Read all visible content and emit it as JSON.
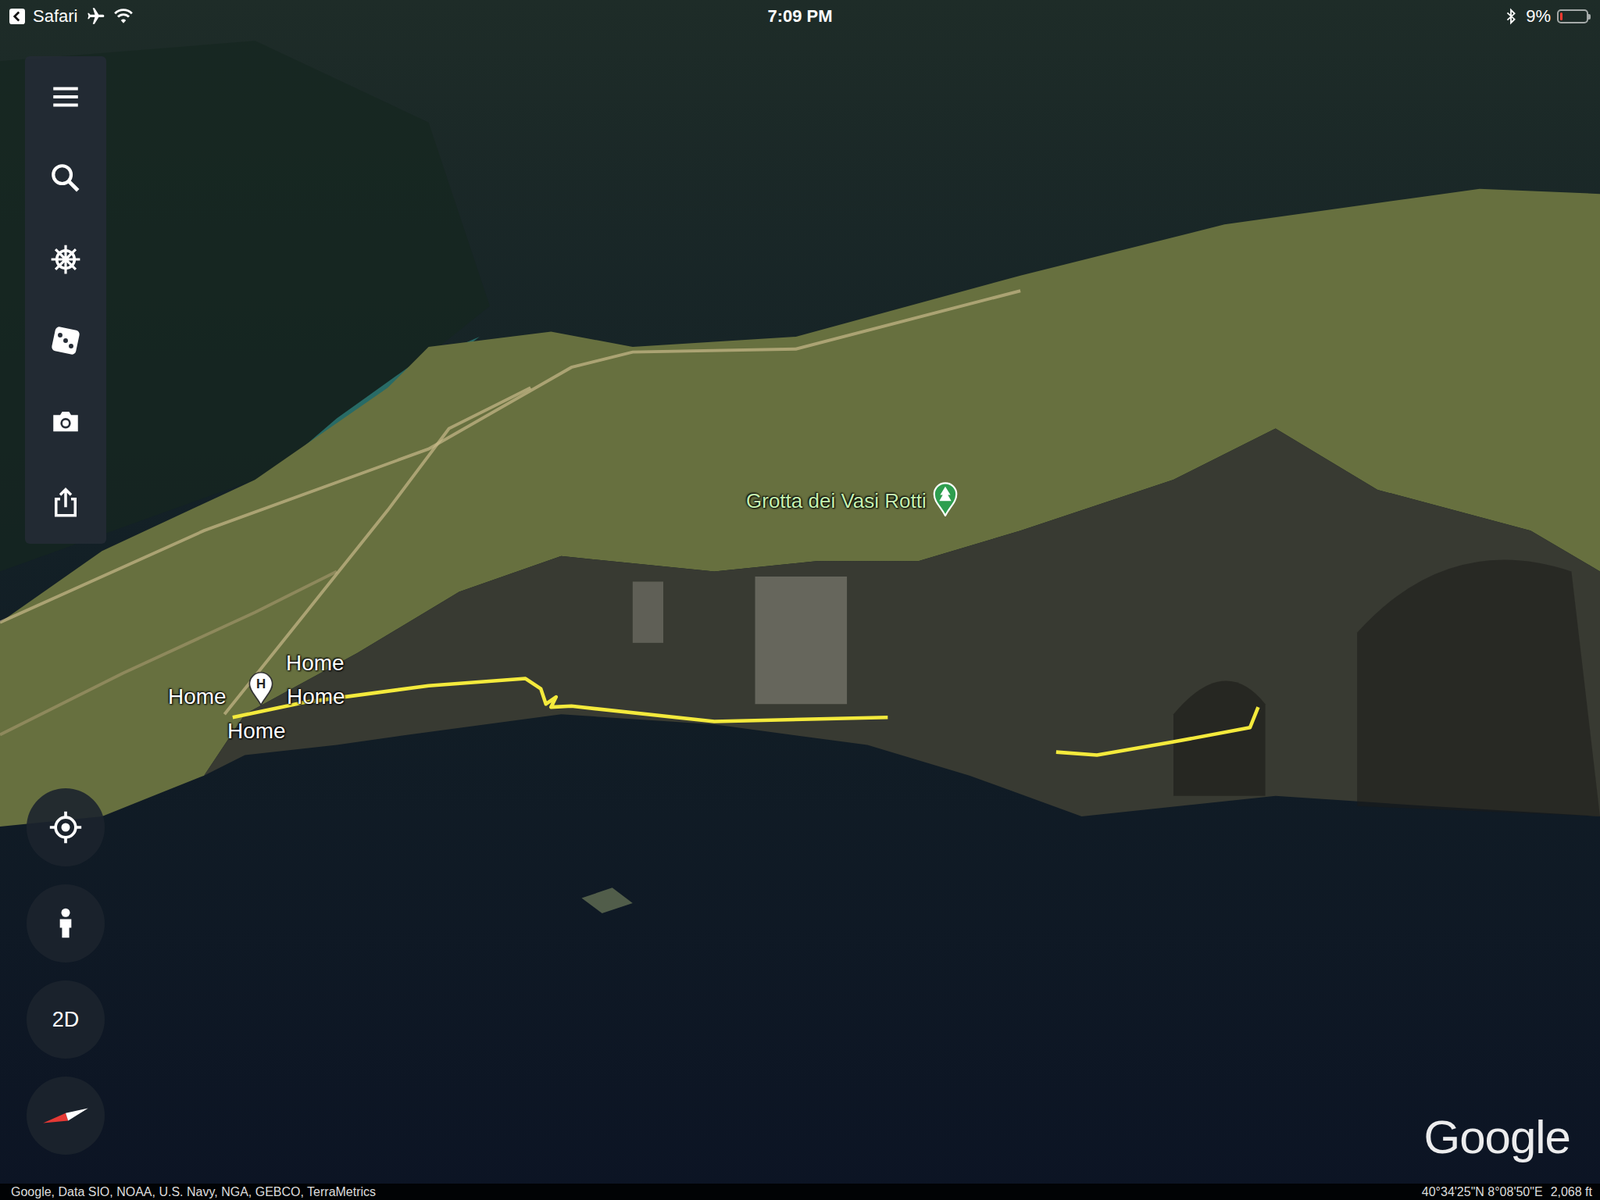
{
  "status_bar": {
    "back_label": "Safari",
    "time": "7:09 PM",
    "battery": "9%",
    "battery_level": 0.09,
    "airplane_mode": true,
    "wifi": true,
    "bluetooth": true
  },
  "map": {
    "places": [
      {
        "name": "Grotta dei Vasi Rotti",
        "kind": "park"
      }
    ],
    "marker": {
      "label": "H"
    },
    "labels": [
      "Home",
      "Home",
      "Home",
      "Home"
    ]
  },
  "controls": {
    "view_toggle": "2D"
  },
  "logo": "Google",
  "footer": {
    "attribution": "Google, Data SIO, NOAA, U.S. Navy, NGA, GEBCO, TerraMetrics",
    "coordinates": "40°34'25\"N 8°08'50\"E",
    "altitude": "2,068 ft"
  }
}
